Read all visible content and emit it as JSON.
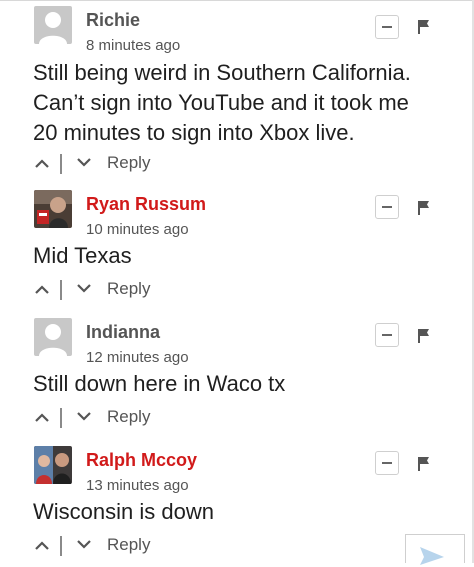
{
  "comments": [
    {
      "author": "Richie",
      "time": "8 minutes ago",
      "lines": [
        "Still being weird in Southern California.",
        "Can’t sign into YouTube and it took me",
        "20 minutes to sign into Xbox live."
      ],
      "reply_label": "Reply",
      "avatar": "default-avatar",
      "author_color": "#555555"
    },
    {
      "author": "Ryan Russum",
      "time": "10 minutes ago",
      "lines": [
        "Mid Texas"
      ],
      "reply_label": "Reply",
      "avatar": "photo-avatar",
      "author_color": "#d11a1a"
    },
    {
      "author": "Indianna",
      "time": "12 minutes ago",
      "lines": [
        "Still down here in Waco tx"
      ],
      "reply_label": "Reply",
      "avatar": "default-avatar",
      "author_color": "#555555"
    },
    {
      "author": "Ralph Mccoy",
      "time": "13 minutes ago",
      "lines": [
        "Wisconsin is down"
      ],
      "reply_label": "Reply",
      "avatar": "photo-avatar",
      "author_color": "#d11a1a"
    }
  ],
  "icons": {
    "collapse": "minus-icon",
    "flag": "flag-icon",
    "upvote": "chevron-up-icon",
    "downvote": "chevron-down-icon"
  }
}
